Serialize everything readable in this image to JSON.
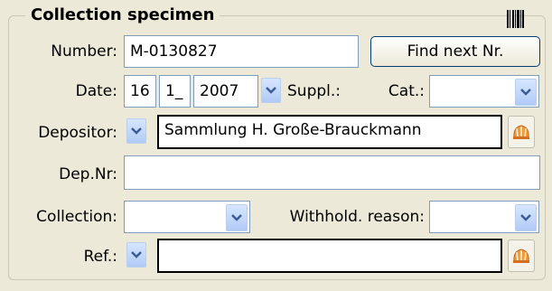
{
  "group": {
    "title": "Collection specimen"
  },
  "number": {
    "label": "Number:",
    "value": "M-0130827",
    "find_button": "Find next Nr."
  },
  "date": {
    "label": "Date:",
    "day": "16",
    "month": "1_",
    "year": "2007",
    "suppl_label": "Suppl.:",
    "cat_label": "Cat.:",
    "cat_value": ""
  },
  "depositor": {
    "label": "Depositor:",
    "value": "Sammlung H. Große-Brauckmann"
  },
  "dep_nr": {
    "label": "Dep.Nr:",
    "value": ""
  },
  "collection": {
    "label": "Collection:",
    "value": "",
    "withhold_label": "Withhold. reason:",
    "withhold_value": ""
  },
  "ref": {
    "label": "Ref.:",
    "value": ""
  },
  "icons": {
    "barcode": "barcode-icon",
    "dropdown": "chevron-down-icon",
    "lookup": "shell-icon"
  },
  "colors": {
    "background": "#ece9d8",
    "accent": "#7f9db9",
    "button_blue": "#c7dafa"
  }
}
